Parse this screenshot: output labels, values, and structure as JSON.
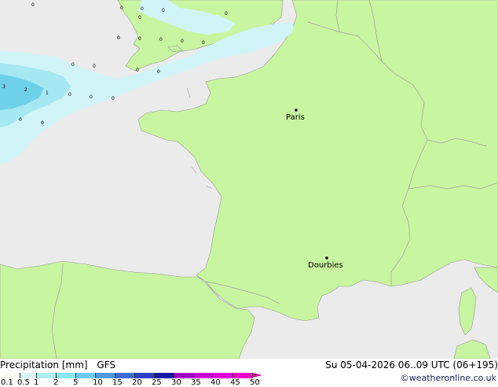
{
  "map": {
    "cities": [
      {
        "name": "Paris"
      },
      {
        "name": "Dourbies"
      }
    ],
    "precip_labels": [
      "0",
      "0",
      "0",
      "0",
      "0",
      "0",
      "0",
      "0",
      "0",
      "0",
      "0",
      "0",
      "0",
      "0",
      "0",
      "0",
      "0",
      "0",
      "0",
      "3",
      "2",
      "1",
      "0",
      "0",
      "0",
      "0",
      "0"
    ]
  },
  "footer": {
    "title": "Precipitation [mm]",
    "model": "GFS",
    "datetime": "Su 05-04-2026 06..09 UTC (06+195)",
    "credit": "©weatheronline.co.uk",
    "scale_ticks": [
      "0.1",
      "0.5",
      "1",
      "2",
      "5",
      "10",
      "15",
      "20",
      "25",
      "30",
      "35",
      "40",
      "45",
      "50"
    ],
    "scale_colors": [
      "#f5fcf5",
      "#d6f6f3",
      "#aef0f3",
      "#8ae6f0",
      "#6cc8ec",
      "#4e9be4",
      "#3c6cd8",
      "#2c40c4",
      "#1818a8",
      "#a400c8",
      "#cc00d8",
      "#e400e0",
      "#f000c8",
      "#e00098"
    ]
  },
  "colors": {
    "land": "#c8f5a0",
    "sea": "#ebebeb",
    "precip_light": "#d0f4f8",
    "precip_mid": "#a6e8f2",
    "precip_heavy": "#6fd0ea",
    "border": "#a0a0a0"
  }
}
